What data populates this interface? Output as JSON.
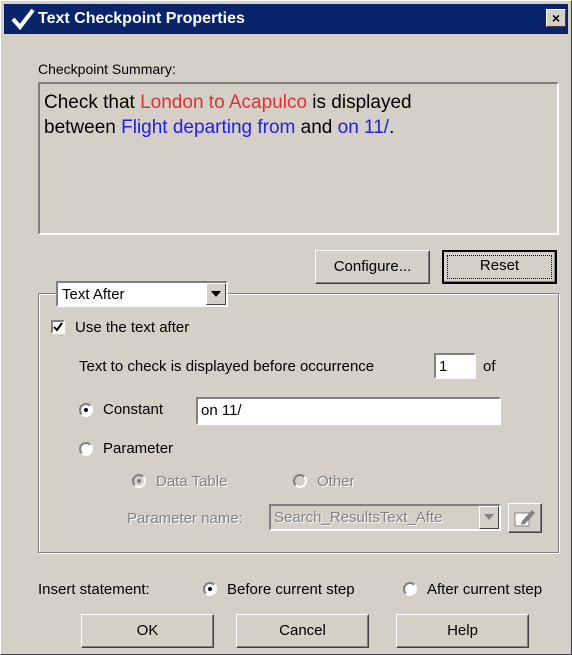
{
  "window": {
    "title": "Text Checkpoint Properties",
    "close": "×"
  },
  "summary": {
    "label": "Checkpoint Summary:",
    "line1_prefix": "Check that ",
    "line1_highlight": "London to Acapulco",
    "line1_suffix": " is  displayed",
    "line2_prefix": "between ",
    "line2_highlight1": "Flight departing from",
    "line2_mid": "  and ",
    "line2_highlight2": "on 11/",
    "line2_suffix": "."
  },
  "buttons": {
    "configure": "Configure...",
    "reset": "Reset",
    "ok": "OK",
    "cancel": "Cancel",
    "help": "Help"
  },
  "group": {
    "dropdown_value": "Text After",
    "use_text_after": "Use the text after",
    "occurrence_label": "Text to check is displayed before occurrence",
    "occurrence_value": "1",
    "occurrence_suffix": "of",
    "constant_label": "Constant",
    "constant_value": "on 11/",
    "parameter_label": "Parameter",
    "data_table_label": "Data Table",
    "other_label": "Other",
    "parameter_name_label": "Parameter name:",
    "parameter_name_value": "Search_ResultsText_Afte"
  },
  "insert": {
    "label": "Insert statement:",
    "before": "Before current step",
    "after": "After current step"
  },
  "colors": {
    "titlebar": "#0a246a",
    "highlight_red": "#e03030",
    "highlight_blue": "#2020e0",
    "face": "#d4d0c8"
  }
}
